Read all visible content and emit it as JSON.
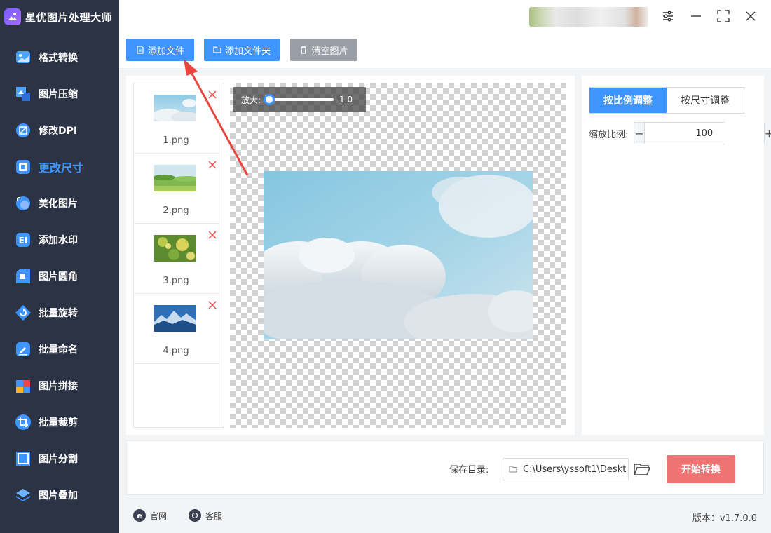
{
  "app": {
    "title": "星优图片处理大师"
  },
  "sidebar": {
    "items": [
      {
        "label": "格式转换",
        "icon": "image-convert-icon",
        "active": false
      },
      {
        "label": "图片压缩",
        "icon": "image-compress-icon",
        "active": false
      },
      {
        "label": "修改DPI",
        "icon": "dpi-icon",
        "active": false
      },
      {
        "label": "更改尺寸",
        "icon": "resize-icon",
        "active": true
      },
      {
        "label": "美化图片",
        "icon": "beautify-icon",
        "active": false
      },
      {
        "label": "添加水印",
        "icon": "watermark-icon",
        "active": false
      },
      {
        "label": "图片圆角",
        "icon": "rounded-corner-icon",
        "active": false
      },
      {
        "label": "批量旋转",
        "icon": "rotate-icon",
        "active": false
      },
      {
        "label": "批量命名",
        "icon": "rename-icon",
        "active": false
      },
      {
        "label": "图片拼接",
        "icon": "puzzle-icon",
        "active": false
      },
      {
        "label": "批量裁剪",
        "icon": "crop-icon",
        "active": false
      },
      {
        "label": "图片分割",
        "icon": "split-icon",
        "active": false
      },
      {
        "label": "图片叠加",
        "icon": "layers-icon",
        "active": false
      }
    ]
  },
  "toolbar": {
    "add_file": "添加文件",
    "add_folder": "添加文件夹",
    "clear": "清空图片"
  },
  "files": [
    {
      "name": "1.png"
    },
    {
      "name": "2.png"
    },
    {
      "name": "3.png"
    },
    {
      "name": "4.png"
    }
  ],
  "preview": {
    "zoom_label": "放大:",
    "zoom_value": "1.0"
  },
  "settings": {
    "tab_ratio": "按比例调整",
    "tab_size": "按尺寸调整",
    "scale_label": "缩放比例:",
    "scale_value": "100",
    "minus": "−",
    "plus": "+"
  },
  "save": {
    "label": "保存目录:",
    "path": "C:\\Users\\yssoft1\\Deskt",
    "start": "开始转换"
  },
  "footer": {
    "website": "官网",
    "support": "客服",
    "version": "版本：v1.7.0.0"
  },
  "colors": {
    "accent": "#3e95ff",
    "sidebar_bg": "#2c3344",
    "start_button": "#f07373",
    "annotation": "#e8473f"
  }
}
